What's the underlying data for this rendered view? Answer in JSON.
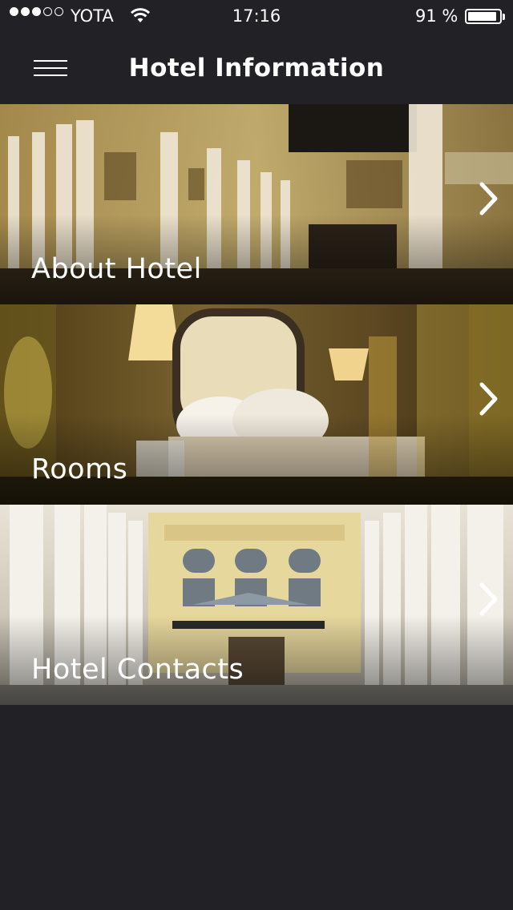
{
  "status_bar": {
    "carrier": "YOTA",
    "time": "17:16",
    "battery_percent": "91 %",
    "battery_level": 0.91,
    "signal_bars_filled": 3,
    "signal_bars_total": 5
  },
  "nav": {
    "title": "Hotel Information",
    "menu_icon": "hamburger-menu-icon"
  },
  "cards": [
    {
      "label": "About Hotel",
      "icon": "chevron-right-icon"
    },
    {
      "label": "Rooms",
      "icon": "chevron-right-icon"
    },
    {
      "label": "Hotel Contacts",
      "icon": "chevron-right-icon"
    }
  ],
  "colors": {
    "background": "#222125",
    "text": "#ffffff"
  }
}
